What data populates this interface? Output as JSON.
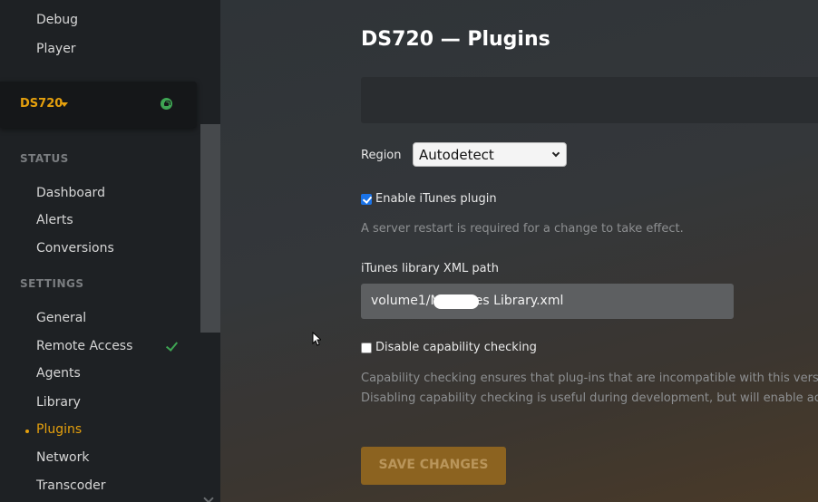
{
  "sidebar": {
    "top_items": [
      "Debug",
      "Player"
    ],
    "server": {
      "name": "DS720"
    },
    "status_header": "STATUS",
    "status_items": [
      "Dashboard",
      "Alerts",
      "Conversions"
    ],
    "settings_header": "SETTINGS",
    "settings_items": [
      "General",
      "Remote Access",
      "Agents",
      "Library",
      "Plugins",
      "Network",
      "Transcoder"
    ],
    "active_item": "Plugins"
  },
  "main": {
    "title": "DS720 — Plugins",
    "region_label": "Region",
    "region_value": "Autodetect",
    "itunes_checkbox_label": "Enable iTunes plugin",
    "itunes_checked": true,
    "restart_hint": "A server restart is required for a change to take effect.",
    "xml_path_label": "iTunes library XML path",
    "xml_path_value": "volume1/M      /iTunes Library.xml",
    "capability_checkbox_label": "Disable capability checking",
    "capability_checked": false,
    "capability_hint_1": "Capability checking ensures that plug-ins that are incompatible with this versio",
    "capability_hint_2": "Disabling capability checking is useful during development, but will enable acc",
    "save_label": "SAVE CHANGES"
  },
  "colors": {
    "accent": "#e5a00d",
    "success": "#3ea553",
    "sidebar_bg": "#1e2124"
  }
}
